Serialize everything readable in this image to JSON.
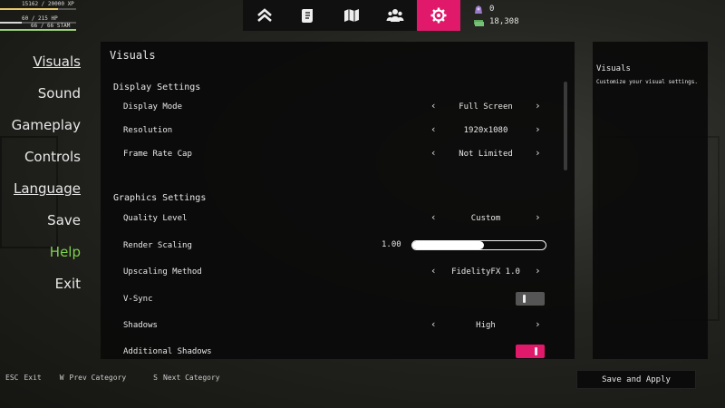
{
  "hud": {
    "xp_text": "15162 / 20000 XP",
    "xp_progress": 0.76,
    "hp_text": "60 / 215 HP",
    "hp_progress": 0.28,
    "stam_text": "66 / 66 STAM",
    "stam_progress": 1.0
  },
  "topnav": {
    "tabs": [
      {
        "icon": "rank-chevrons-icon"
      },
      {
        "icon": "scroll-icon"
      },
      {
        "icon": "map-icon"
      },
      {
        "icon": "people-icon"
      },
      {
        "icon": "gear-icon",
        "active": true
      }
    ],
    "active_color": "#e0196b"
  },
  "currency": {
    "token_count": "0",
    "cash_amount": "18,308"
  },
  "menu": {
    "items": [
      "Visuals",
      "Sound",
      "Gameplay",
      "Controls",
      "Language",
      "Save",
      "Help",
      "Exit"
    ],
    "help_color": "#7fd04f"
  },
  "panel": {
    "title": "Visuals",
    "display_section": "Display Settings",
    "graphics_section": "Graphics Settings",
    "display_mode": {
      "label": "Display Mode",
      "value": "Full Screen"
    },
    "resolution": {
      "label": "Resolution",
      "value": "1920x1080"
    },
    "frame_rate_cap": {
      "label": "Frame Rate Cap",
      "value": "Not Limited"
    },
    "quality_level": {
      "label": "Quality Level",
      "value": "Custom"
    },
    "render_scaling": {
      "label": "Render Scaling",
      "value": "1.00",
      "fill_fraction": 0.54
    },
    "upscaling_method": {
      "label": "Upscaling Method",
      "value": "FidelityFX 1.0"
    },
    "vsync": {
      "label": "V-Sync",
      "on": false
    },
    "shadows": {
      "label": "Shadows",
      "value": "High"
    },
    "additional_shadows": {
      "label": "Additional Shadows",
      "on": true
    }
  },
  "info": {
    "title": "Visuals",
    "description": "Customize your visual settings."
  },
  "footer": {
    "esc_key": "ESC",
    "esc_label": "Exit",
    "w_key": "W",
    "w_label": "Prev Category",
    "s_key": "S",
    "s_label": "Next Category",
    "apply_label": "Save and Apply"
  }
}
